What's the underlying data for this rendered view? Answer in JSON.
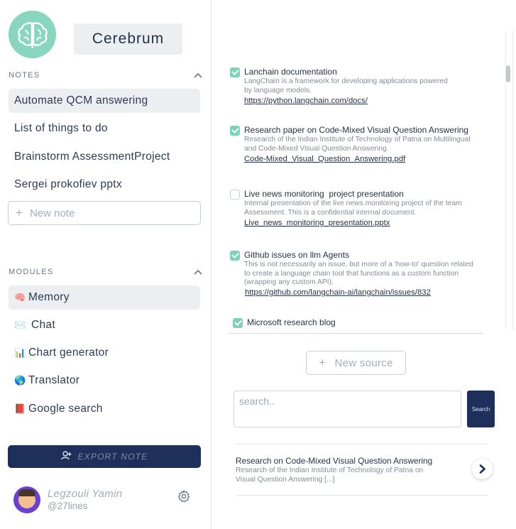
{
  "app": {
    "title": "Cerebrum",
    "logo_icon": "brain-icon"
  },
  "notes": {
    "heading": "NOTES",
    "items": [
      {
        "label": "Automate QCM answering",
        "active": true
      },
      {
        "label": "List of things to do",
        "active": false
      },
      {
        "label": "Brainstorm AssessmentProject",
        "active": false
      },
      {
        "label": "Sergei prokofiev pptx",
        "active": false
      }
    ],
    "new_note_placeholder": "New note"
  },
  "modules": {
    "heading": "MODULES",
    "items": [
      {
        "emoji": "🧠",
        "label": "Memory",
        "active": true
      },
      {
        "emoji": "✉️",
        "label": "Chat",
        "active": false
      },
      {
        "emoji": "📊",
        "label": "Chart generator",
        "active": false
      },
      {
        "emoji": "🌎",
        "label": "Translator",
        "active": false
      },
      {
        "emoji": "📕",
        "label": "Google search",
        "active": false
      }
    ]
  },
  "export_button": {
    "label": "EXPORT NOTE",
    "icon": "add-user-icon"
  },
  "user": {
    "name": "Legzouli Yamin",
    "handle": "@27lines",
    "settings_icon": "gear-icon"
  },
  "sources": [
    {
      "checked": true,
      "title": "Lanchain documentation",
      "desc_lines": [
        "LangChain is a framework for developing applications powered",
        "by language models."
      ],
      "link": "https://python.langchain.com/docs/"
    },
    {
      "checked": true,
      "title": "Research paper on Code-Mixed Visual Question Answering",
      "desc_lines": [
        "Research of the Indian Institute of Technology of Patna on Multilingual",
        "and Code-Mixed Visual Question Answering."
      ],
      "link": "Code-Mixed_Visual_Question_Answering.pdf"
    },
    {
      "checked": false,
      "title": "Live news monitoring  project presentation",
      "desc_lines": [
        "Internal presentation of the live news monitoring project of the team",
        "Assessment. This is a confidential internal document."
      ],
      "link": "Live_news_monitoring_presentation.pptx"
    },
    {
      "checked": true,
      "title": "Github issues on llm Agents",
      "desc_lines": [
        "This is not necessarily an issue, but more of a 'how-to' question related",
        "to create a language chain tool that functions as a custom function",
        "(wrapping any custom API)."
      ],
      "link": "https://github.com/langchain-ai/langchain/issues/832"
    },
    {
      "checked": true,
      "title": "Microsoft research blog",
      "desc_lines": [],
      "link": ""
    }
  ],
  "new_source_label": "New source",
  "search": {
    "placeholder": "search..",
    "button_label": "Search"
  },
  "result": {
    "title": "Research on Code-Mixed Visual Question Answering",
    "desc_lines": [
      "Research of the Indian Institute of Technology of Patna on",
      "Visual Question Answering [...]"
    ],
    "arrow_icon": "chevron-right-icon"
  },
  "colors": {
    "accent": "#7dd2b9",
    "logo_bg": "#87d6bd",
    "primary": "#1f2f5b",
    "avatar_bg": "#6a3fd3"
  }
}
